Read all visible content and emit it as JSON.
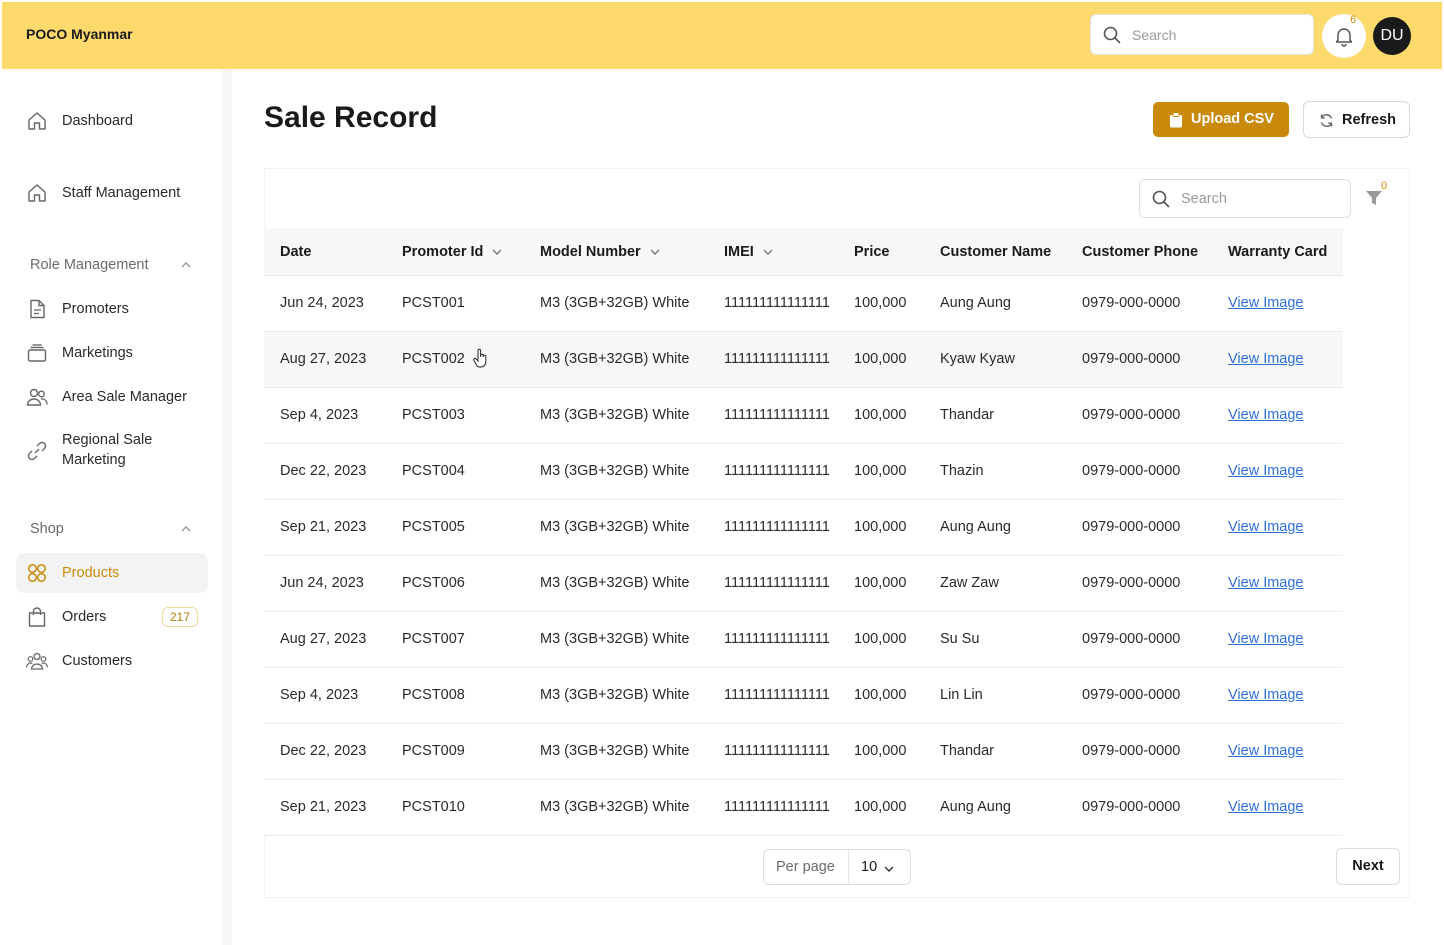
{
  "header": {
    "brand": "POCO Myanmar",
    "search_placeholder": "Search",
    "notification_count": "6",
    "avatar_initials": "DU"
  },
  "sidebar": {
    "items": [
      {
        "label": "Dashboard",
        "icon": "home-icon"
      },
      {
        "label": "Staff Management",
        "icon": "home-icon"
      }
    ],
    "role_section": {
      "title": "Role Management",
      "items": [
        {
          "label": "Promoters",
          "icon": "document-icon"
        },
        {
          "label": "Marketings",
          "icon": "stack-icon"
        },
        {
          "label": "Area Sale Manager",
          "icon": "users-icon"
        },
        {
          "label": "Regional Sale Marketing",
          "icon": "link-icon"
        }
      ]
    },
    "shop_section": {
      "title": "Shop",
      "items": [
        {
          "label": "Products",
          "icon": "grid-icon",
          "active": true
        },
        {
          "label": "Orders",
          "icon": "bag-icon",
          "badge": "217"
        },
        {
          "label": "Customers",
          "icon": "group-icon"
        }
      ]
    }
  },
  "main": {
    "title": "Sale Record",
    "upload_label": "Upload CSV",
    "refresh_label": "Refresh",
    "table_search_placeholder": "Search",
    "filter_count": "0",
    "columns": [
      "Date",
      "Promoter Id",
      "Model Number",
      "IMEI",
      "Price",
      "Customer Name",
      "Customer Phone",
      "Warranty Card"
    ],
    "rows": [
      [
        "Jun 24, 2023",
        "PCST001",
        "M3 (3GB+32GB) White",
        "111111111111111",
        "100,000",
        "Aung Aung",
        "0979-000-0000",
        "View Image"
      ],
      [
        "Aug 27, 2023",
        "PCST002",
        "M3 (3GB+32GB) White",
        "111111111111111",
        "100,000",
        "Kyaw Kyaw",
        "0979-000-0000",
        "View Image"
      ],
      [
        "Sep 4, 2023",
        "PCST003",
        "M3 (3GB+32GB) White",
        "111111111111111",
        "100,000",
        "Thandar",
        "0979-000-0000",
        "View Image"
      ],
      [
        "Dec 22, 2023",
        "PCST004",
        "M3 (3GB+32GB) White",
        "111111111111111",
        "100,000",
        "Thazin",
        "0979-000-0000",
        "View Image"
      ],
      [
        "Sep 21, 2023",
        "PCST005",
        "M3 (3GB+32GB) White",
        "111111111111111",
        "100,000",
        "Aung Aung",
        "0979-000-0000",
        "View Image"
      ],
      [
        "Jun 24, 2023",
        "PCST006",
        "M3 (3GB+32GB) White",
        "111111111111111",
        "100,000",
        "Zaw Zaw",
        "0979-000-0000",
        "View Image"
      ],
      [
        "Aug 27, 2023",
        "PCST007",
        "M3 (3GB+32GB) White",
        "111111111111111",
        "100,000",
        "Su Su",
        "0979-000-0000",
        "View Image"
      ],
      [
        "Sep 4, 2023",
        "PCST008",
        "M3 (3GB+32GB) White",
        "111111111111111",
        "100,000",
        "Lin Lin",
        "0979-000-0000",
        "View Image"
      ],
      [
        "Dec 22, 2023",
        "PCST009",
        "M3 (3GB+32GB) White",
        "111111111111111",
        "100,000",
        "Thandar",
        "0979-000-0000",
        "View Image"
      ],
      [
        "Sep 21, 2023",
        "PCST010",
        "M3 (3GB+32GB) White",
        "111111111111111",
        "100,000",
        "Aung Aung",
        "0979-000-0000",
        "View Image"
      ]
    ],
    "pagination": {
      "per_page_label": "Per page",
      "per_page_value": "10",
      "next_label": "Next"
    }
  },
  "colors": {
    "header_bg": "#fed96b",
    "accent": "#c98a0c",
    "link": "#2f6fd6"
  }
}
